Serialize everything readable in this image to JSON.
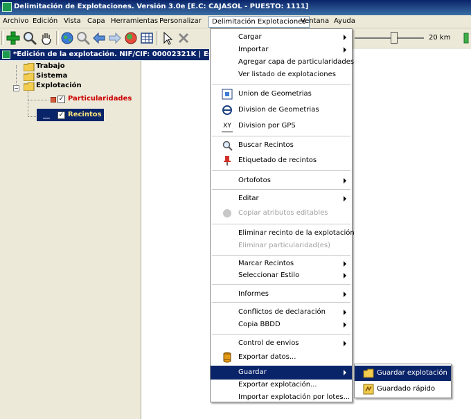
{
  "window": {
    "title": "Delimitación de Explotaciones. Versión 3.0e   [E.C: CAJASOL - PUESTO: 1111]"
  },
  "menubar": {
    "items": [
      "Archivo",
      "Edición",
      "Vista",
      "Capa",
      "Herramientas",
      "Personalizar",
      "Delimitación Explotaciones",
      "Ventana",
      "Ayuda"
    ]
  },
  "toolbar": {
    "icons": [
      "add-icon",
      "zoom-icon",
      "pan-hand-icon",
      "globe-icon",
      "zoom-out-icon",
      "back-arrow-icon",
      "forward-arrow-icon",
      "layers-icon",
      "grid-icon",
      "select-pointer-icon",
      "tool-icon"
    ],
    "scale_label": "20 km",
    "scale_slider_level": 0.57
  },
  "panel": {
    "title": "*Edición de la explotación. NIF/CIF: 00002321K | Est"
  },
  "tree": {
    "trabajo": "Trabajo",
    "sistema": "Sistema",
    "explotacion": "Explotación",
    "particularidades": "Particularidades",
    "recintos": "Recintos"
  },
  "menu": {
    "cargar": "Cargar",
    "importar": "Importar",
    "agregar_capa": "Agregar capa de particularidades",
    "ver_listado": "Ver listado de explotaciones",
    "union": "Union de Geometrias",
    "division": "Division de Geometrias",
    "division_gps": "Division por GPS",
    "buscar": "Buscar Recintos",
    "etiquetado": "Etiquetado de recintos",
    "ortofotos": "Ortofotos",
    "editar": "Editar",
    "copiar_atributos": "Copiar atributos editables",
    "eliminar_recinto": "Eliminar recinto de la explotación",
    "eliminar_particularidad": "Eliminar particularidad(es)",
    "marcar": "Marcar Recintos",
    "seleccionar_estilo": "Seleccionar Estilo",
    "informes": "Informes",
    "conflictos": "Conflictos de declaración",
    "copia_bbdd": "Copia BBDD",
    "control_envios": "Control de envios",
    "exportar_datos": "Exportar datos...",
    "guardar": "Guardar",
    "exportar_explotacion": "Exportar explotación...",
    "importar_lotes": "Importar explotación por lotes...",
    "xy_icon_text": "XY"
  },
  "submenu": {
    "guardar_explotacion": "Guardar explotación",
    "guardado_rapido": "Guardado rápido"
  },
  "colors": {
    "highlight": "#0a246a",
    "particularidades_text": "#cc0000",
    "chrome": "#ece9d8"
  }
}
